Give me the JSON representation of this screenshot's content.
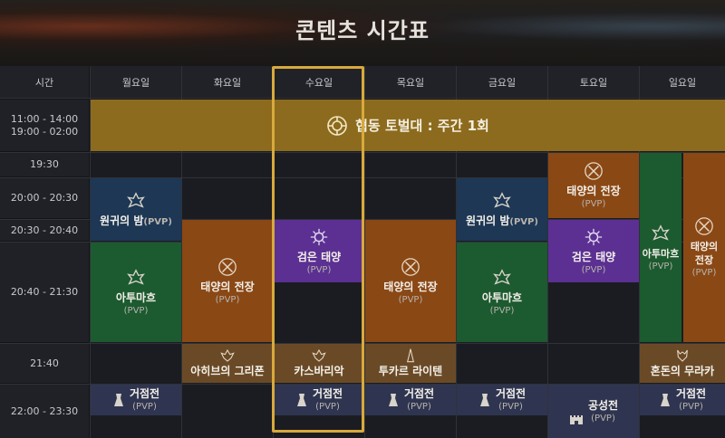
{
  "header": {
    "title": "콘텐츠 시간표"
  },
  "columns": {
    "time_label": "시간",
    "days": [
      "월요일",
      "화요일",
      "수요일",
      "목요일",
      "금요일",
      "토요일",
      "일요일"
    ]
  },
  "time_rows": [
    {
      "line1": "11:00 - 14:00",
      "line2": "19:00 - 02:00"
    },
    {
      "line1": "19:30",
      "line2": ""
    },
    {
      "line1": "20:00 - 20:30",
      "line2": ""
    },
    {
      "line1": "20:30 - 20:40",
      "line2": ""
    },
    {
      "line1": "20:40 - 21:30",
      "line2": ""
    },
    {
      "line1": "21:40",
      "line2": ""
    },
    {
      "line1": "22:00 - 23:30",
      "line2": ""
    }
  ],
  "banner": {
    "label": "협동 토벌대 : 주간 1회",
    "icon": "raid-emblem-icon",
    "color": "#8c6b1e"
  },
  "events": {
    "mon_night": {
      "name": "원귀의 밤",
      "sub": "(PVP)",
      "icon": "dragon-crest-icon"
    },
    "mon_atuma": {
      "name": "아투마흐",
      "sub": "(PVP)",
      "icon": "dragon-crest-icon"
    },
    "mon_base": {
      "name": "거점전",
      "sub": "(PVP)",
      "icon": "fortress-icon"
    },
    "tue_sun": {
      "name": "태양의 전장",
      "sub": "(PVP)",
      "icon": "crossed-swords-icon"
    },
    "tue_griffon": {
      "name": "아히브의 그리폰",
      "sub": "",
      "icon": "wing-crest-icon"
    },
    "wed_dark": {
      "name": "검은 태양",
      "sub": "(PVP)",
      "icon": "dark-sun-icon"
    },
    "wed_kas": {
      "name": "카스바리악",
      "sub": "",
      "icon": "wing-crest-icon"
    },
    "wed_base": {
      "name": "거점전",
      "sub": "(PVP)",
      "icon": "fortress-icon"
    },
    "thu_sun": {
      "name": "태양의 전장",
      "sub": "(PVP)",
      "icon": "crossed-swords-icon"
    },
    "thu_tukar": {
      "name": "투카르 라이텐",
      "sub": "",
      "icon": "spire-icon"
    },
    "thu_base": {
      "name": "거점전",
      "sub": "(PVP)",
      "icon": "fortress-icon"
    },
    "fri_night": {
      "name": "원귀의 밤",
      "sub": "(PVP)",
      "icon": "dragon-crest-icon"
    },
    "fri_atuma": {
      "name": "아투마흐",
      "sub": "(PVP)",
      "icon": "dragon-crest-icon"
    },
    "fri_base": {
      "name": "거점전",
      "sub": "(PVP)",
      "icon": "fortress-icon"
    },
    "sat_sun": {
      "name": "태양의 전장",
      "sub": "(PVP)",
      "icon": "crossed-swords-icon"
    },
    "sat_dark": {
      "name": "검은 태양",
      "sub": "(PVP)",
      "icon": "dark-sun-icon"
    },
    "sat_siege": {
      "name": "공성전",
      "sub": "(PVP)",
      "icon": "castle-icon"
    },
    "sun_atuma": {
      "name": "아투마흐",
      "sub": "(PVP)",
      "icon": "dragon-crest-icon"
    },
    "sun_sun": {
      "name": "태양의 전장",
      "sub": "(PVP)",
      "icon": "crossed-swords-icon"
    },
    "sun_murak": {
      "name": "혼돈의 무라카",
      "sub": "",
      "icon": "demon-crest-icon"
    },
    "sun_base": {
      "name": "거점전",
      "sub": "(PVP)",
      "icon": "fortress-icon"
    }
  },
  "colors": {
    "navy": "#1d3754",
    "green": "#1c5a2f",
    "orange": "#8a4815",
    "purple": "#5b3092",
    "brown": "#6a4a26",
    "slate": "#2f3550",
    "gold": "#8c6b1e",
    "highlight": "#d8a93c"
  }
}
